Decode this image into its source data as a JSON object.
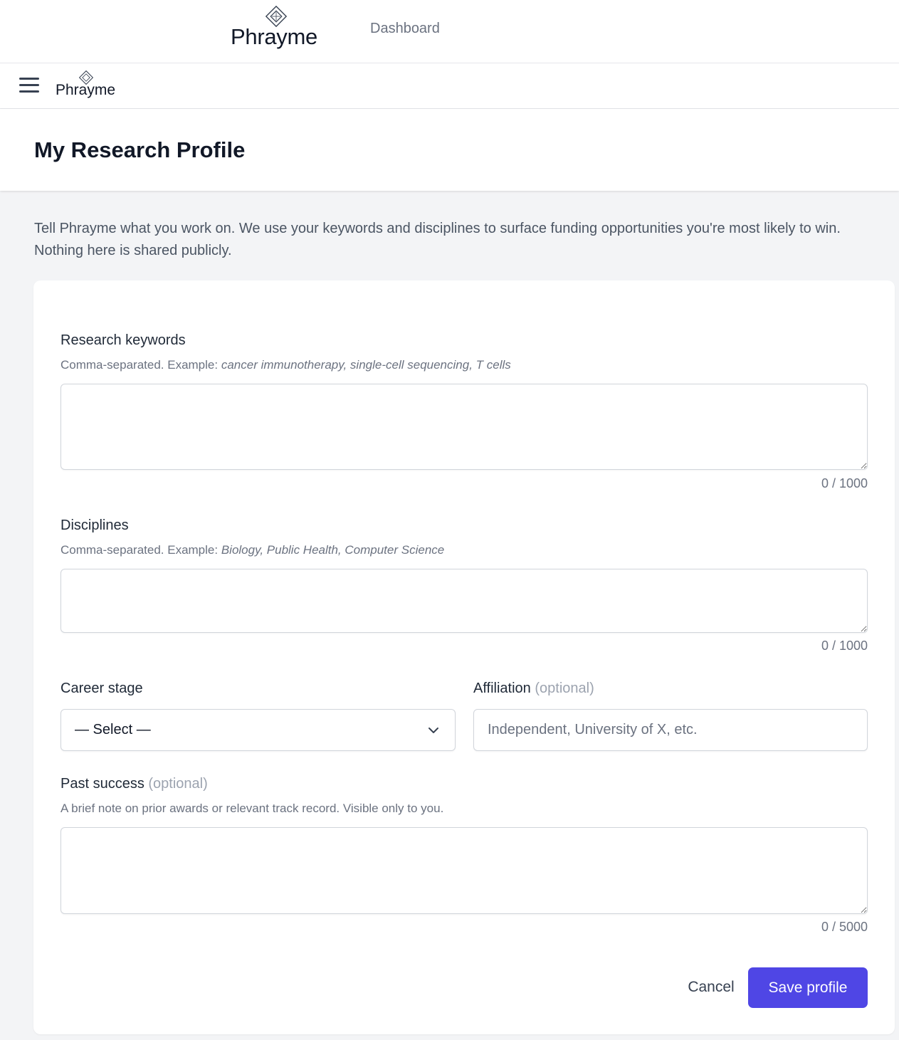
{
  "colors": {
    "accent": "#4f46e5",
    "page_bg": "#f3f4f6"
  },
  "topnav": {
    "brand": "Phrayme",
    "dashboard_link": "Dashboard"
  },
  "mobilebar": {
    "brand": "Phrayme",
    "menu_icon": "hamburger-menu-icon"
  },
  "page": {
    "title": "My Research Profile",
    "intro": "Tell Phrayme what you work on. We use your keywords and disciplines to surface funding opportunities you're most likely to win. Nothing here is shared publicly."
  },
  "form": {
    "keywords": {
      "label": "Research keywords",
      "hint_prefix": "Comma-separated. Example: ",
      "hint_example": "cancer immunotherapy, single-cell sequencing, T cells",
      "value": "",
      "counter": "0 / 1000"
    },
    "disciplines": {
      "label": "Disciplines",
      "hint_prefix": "Comma-separated. Example: ",
      "hint_example": "Biology, Public Health, Computer Science",
      "value": "",
      "counter": "0 / 1000"
    },
    "career_stage": {
      "label": "Career stage",
      "selected": "— Select —"
    },
    "affiliation": {
      "label": "Affiliation",
      "optional": "(optional)",
      "placeholder": "Independent, University of X, etc.",
      "value": ""
    },
    "past_success": {
      "label": "Past success",
      "optional": "(optional)",
      "hint": "A brief note on prior awards or relevant track record. Visible only to you.",
      "value": "",
      "counter": "0 / 5000"
    },
    "actions": {
      "cancel": "Cancel",
      "save": "Save profile"
    }
  }
}
